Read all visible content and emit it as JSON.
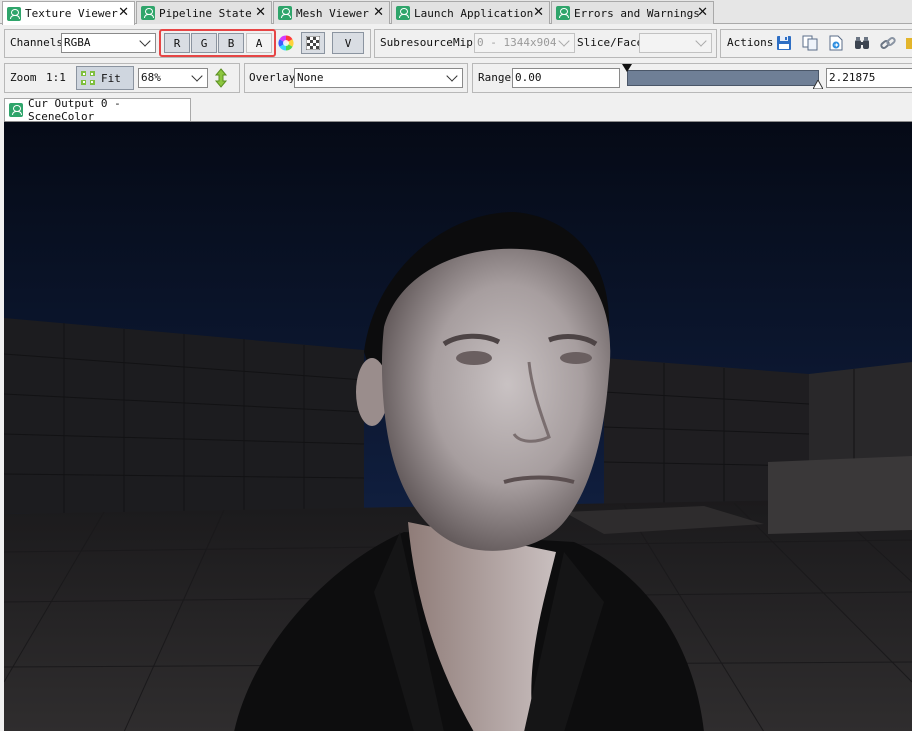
{
  "tabs": [
    {
      "label": "Texture Viewer",
      "active": true
    },
    {
      "label": "Pipeline State",
      "active": false
    },
    {
      "label": "Mesh Viewer",
      "active": false
    },
    {
      "label": "Launch Application",
      "active": false
    },
    {
      "label": "Errors and Warnings",
      "active": false
    }
  ],
  "toolbar1": {
    "channels_label": "Channels",
    "channels_value": "RGBA",
    "channel_buttons": [
      "R",
      "G",
      "B",
      "A"
    ],
    "flip_button": "V",
    "subresource_label": "Subresource",
    "mip_label": "Mip",
    "mip_value": "0 - 1344x904",
    "slice_label": "Slice/Face",
    "slice_value": "",
    "actions_label": "Actions"
  },
  "toolbar2": {
    "zoom_label": "Zoom",
    "zoom_one": "1:1",
    "fit_label": "Fit",
    "zoom_value": "68%",
    "overlay_label": "Overlay",
    "overlay_value": "None",
    "range_label": "Range",
    "range_min": "0.00",
    "range_max": "2.21875"
  },
  "viewer": {
    "subtab_label": "Cur Output 0 - SceneColor"
  },
  "icons": {
    "tab": "viewer-tab-icon",
    "color_wheel": "color-wheel-icon",
    "checker": "checkerboard-icon",
    "save": "save-icon",
    "copy": "copy-icon",
    "goto": "goto-location-icon",
    "find": "binoculars-icon",
    "link": "link-icon",
    "fit": "fit-to-window-icon",
    "auto_range": "auto-range-icon"
  },
  "colors": {
    "highlight": "#e64545",
    "tab_icon": "#2fa56b",
    "channel_on": "#d9dde3"
  }
}
